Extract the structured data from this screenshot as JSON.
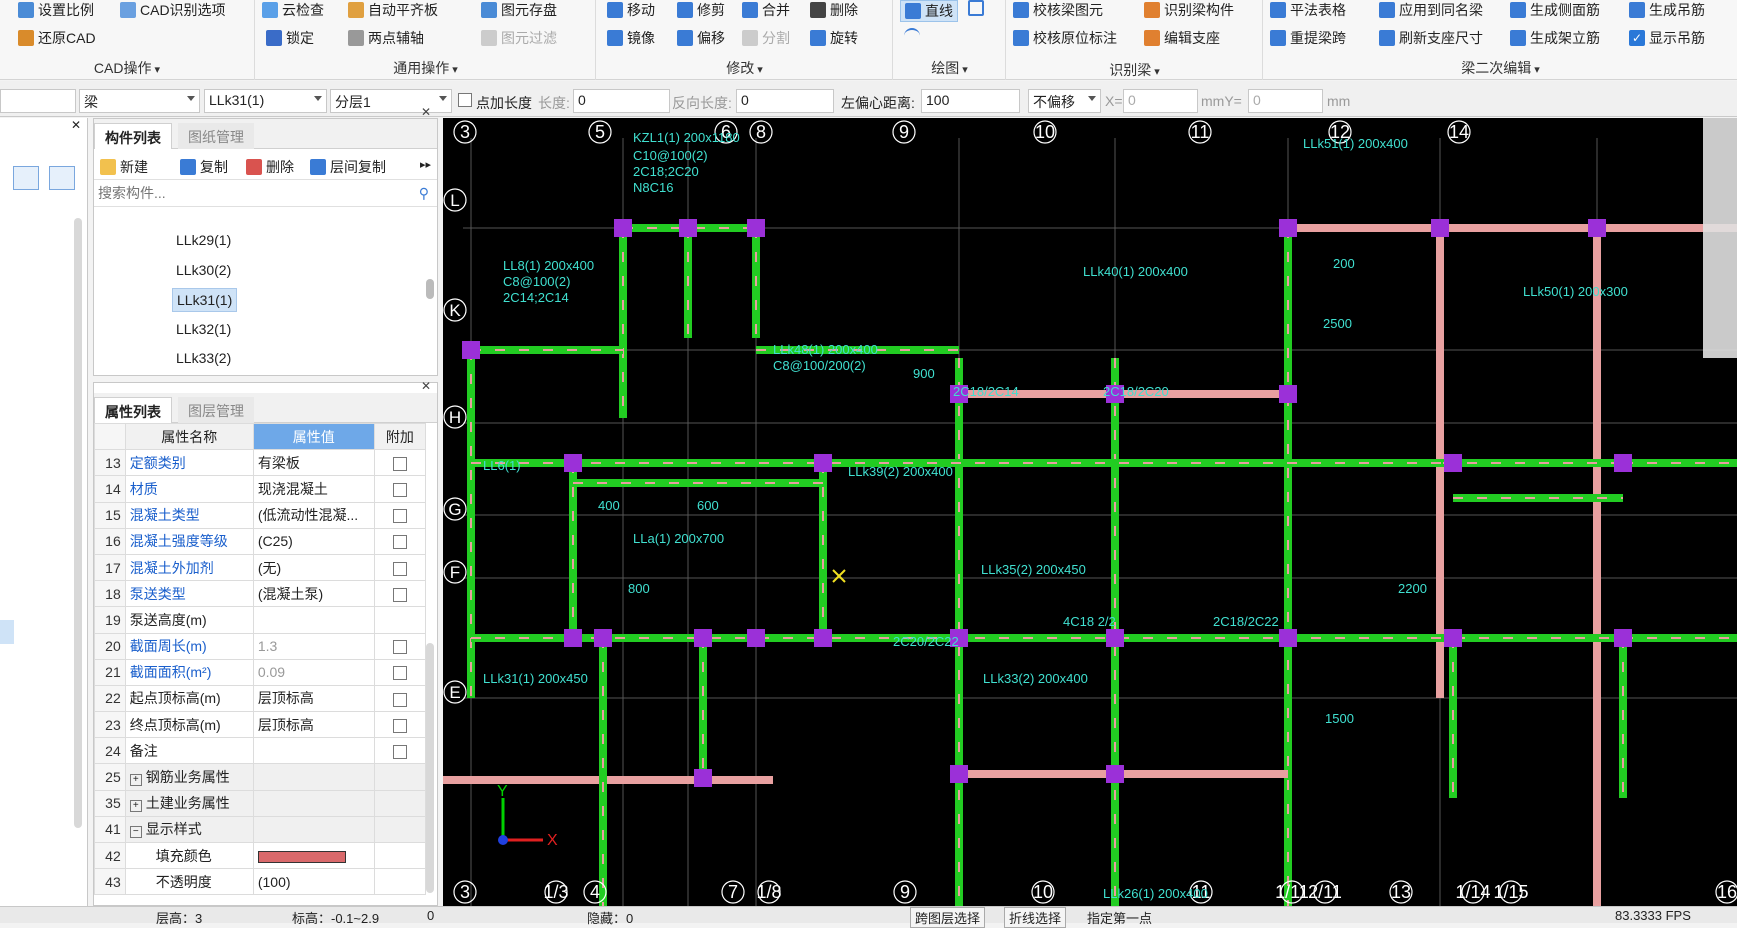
{
  "ribbon": {
    "cad_group": {
      "title": "CAD操作",
      "set_scale": "设置比例",
      "cad_options": "CAD识别选项",
      "restore_cad": "还原CAD"
    },
    "general_group": {
      "title": "通用操作",
      "cloud_check": "云检查",
      "auto_align": "自动平齐板",
      "lock": "锁定",
      "two_point_axis": "两点辅轴",
      "element_save": "图元存盘",
      "element_filter": "图元过滤"
    },
    "modify_group": {
      "title": "修改",
      "move": "移动",
      "trim": "修剪",
      "merge": "合并",
      "delete": "删除",
      "mirror": "镜像",
      "offset": "偏移",
      "split": "分割",
      "rotate": "旋转"
    },
    "draw_group": {
      "title": "绘图",
      "line": "直线"
    },
    "recognize_group": {
      "title": "识别梁",
      "check_beam": "校核梁图元",
      "recognize_beam": "识别梁构件",
      "check_origin": "校核原位标注",
      "edit_support": "编辑支座"
    },
    "beam2_group": {
      "title": "梁二次编辑",
      "flat_table": "平法表格",
      "apply_same": "应用到同名梁",
      "gen_side_rebar": "生成侧面筋",
      "gen_hanger": "生成吊筋",
      "relift": "重提梁跨",
      "refresh_support": "刷新支座尺寸",
      "gen_stirrup": "生成架立筋",
      "show_hanger": "显示吊筋"
    }
  },
  "toolbar": {
    "floor_select": "",
    "type_select": "梁",
    "element_select": "LLk31(1)",
    "layer_select": "分层1",
    "add_length_label": "点加长度",
    "length_label": "长度:",
    "length_value": "0",
    "reverse_length_label": "反向长度:",
    "reverse_length_value": "0",
    "left_offset_label": "左偏心距离:",
    "left_offset_value": "100",
    "offset_mode": "不偏移",
    "x_label": "X=",
    "x_value": "0",
    "mmy_label": "mmY=",
    "y_value": "0",
    "mm_label": "mm"
  },
  "component_panel": {
    "tab_list": "构件列表",
    "tab_drawing": "图纸管理",
    "new": "新建",
    "copy": "复制",
    "delete": "删除",
    "floor_copy": "层间复制",
    "search_placeholder": "搜索构件...",
    "items": [
      "LLk29(1)",
      "LLk30(2)",
      "LLk31(1)",
      "LLk32(1)",
      "LLk33(2)"
    ]
  },
  "property_panel": {
    "tab_props": "属性列表",
    "tab_layers": "图层管理",
    "col_name": "属性名称",
    "col_value": "属性值",
    "col_extra": "附加",
    "rows": [
      {
        "idx": "13",
        "name": "定额类别",
        "value": "有梁板"
      },
      {
        "idx": "14",
        "name": "材质",
        "value": "现浇混凝土"
      },
      {
        "idx": "15",
        "name": "混凝土类型",
        "value": "(低流动性混凝..."
      },
      {
        "idx": "16",
        "name": "混凝土强度等级",
        "value": "(C25)"
      },
      {
        "idx": "17",
        "name": "混凝土外加剂",
        "value": "(无)"
      },
      {
        "idx": "18",
        "name": "泵送类型",
        "value": "(混凝土泵)"
      },
      {
        "idx": "19",
        "name": "泵送高度(m)",
        "value": ""
      },
      {
        "idx": "20",
        "name": "截面周长(m)",
        "value": "1.3"
      },
      {
        "idx": "21",
        "name": "截面面积(m²)",
        "value": "0.09"
      },
      {
        "idx": "22",
        "name": "起点顶标高(m)",
        "value": "层顶标高"
      },
      {
        "idx": "23",
        "name": "终点顶标高(m)",
        "value": "层顶标高"
      },
      {
        "idx": "24",
        "name": "备注",
        "value": ""
      },
      {
        "idx": "25",
        "name": "钢筋业务属性",
        "value": ""
      },
      {
        "idx": "35",
        "name": "土建业务属性",
        "value": ""
      },
      {
        "idx": "41",
        "name": "显示样式",
        "value": ""
      },
      {
        "idx": "42",
        "name": "填充颜色",
        "value": ""
      },
      {
        "idx": "43",
        "name": "不透明度",
        "value": "(100)"
      }
    ]
  },
  "cad": {
    "axis_top": [
      "3",
      "5",
      "6",
      "8",
      "9",
      "10",
      "11",
      "12",
      "14"
    ],
    "axis_bottom": [
      "3",
      "1/3",
      "4",
      "7",
      "1/8",
      "9",
      "10",
      "11",
      "1/11",
      "2/11",
      "13",
      "1/14",
      "1/15",
      "16"
    ],
    "axis_left": [
      "L",
      "K",
      "H",
      "G",
      "F",
      "E"
    ],
    "labels": [
      "KZL1(1) 200x1180",
      "C10@100(2)",
      "2C18;2C20",
      "N8C16",
      "LL8(1) 200x400",
      "C8@100(2)",
      "2C14;2C14",
      "LLk48(1) 200x400",
      "C8@100/200(2)",
      "LLk39(2) 200x400",
      "LLk35(2) 200x450",
      "LLk40(1) 200x400",
      "LLk51(1) 200x400",
      "LLk50(1) 200x300",
      "LL6(1)",
      "LLa(1) 200x700",
      "LLk31(1) 200x450",
      "LLk33(2) 200x400",
      "2C18/2C14",
      "2C18/2C20",
      "4C18 2/2",
      "2C20/2C22",
      "2C18/2C22",
      "400",
      "600",
      "800",
      "2200",
      "900",
      "2500",
      "1500",
      "200",
      "LLk26(1) 200x400"
    ]
  },
  "status": {
    "floor_height": "层高：3",
    "elevation": "标高：-0.1~2.9",
    "value0": "0",
    "hidden": "隐藏：0",
    "cross_select": "跨图层选择",
    "polyline_select": "折线选择",
    "prompt": "指定第一点",
    "coords": "83.3333 FPS"
  },
  "colors": {
    "beam_green": "#22cc22",
    "beam_pink": "#e8a0a0",
    "wall_purple": "#9b30d8",
    "axis_white": "#ffffff",
    "annot_cyan": "#40e0d0",
    "fill_color": "#d9696b"
  }
}
